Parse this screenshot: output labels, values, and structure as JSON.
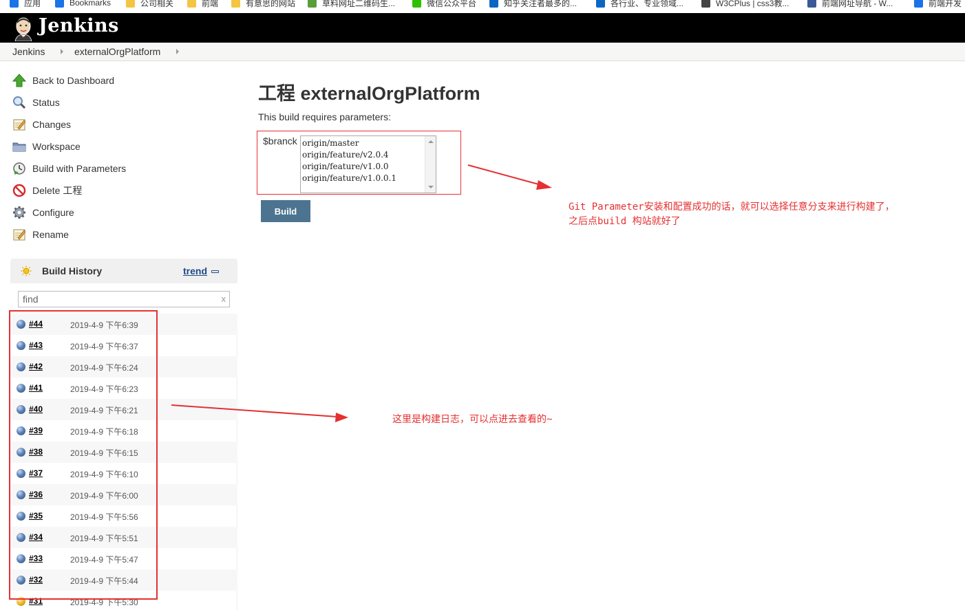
{
  "bookmarks": [
    {
      "label": "应用",
      "icon": "apps-grid-icon",
      "color": "#1a73e8"
    },
    {
      "label": "Bookmarks",
      "icon": "star-icon",
      "color": "#1a73e8"
    },
    {
      "label": "公司相关",
      "icon": "folder-icon",
      "color": "#f4c542"
    },
    {
      "label": "前端",
      "icon": "folder-icon",
      "color": "#f4c542"
    },
    {
      "label": "有意思的网站",
      "icon": "folder-icon",
      "color": "#f4c542"
    },
    {
      "label": "草料网址二维码生...",
      "icon": "qr-icon",
      "color": "#5a9e3a"
    },
    {
      "label": "微信公众平台",
      "icon": "wechat-icon",
      "color": "#2dc100"
    },
    {
      "label": "知乎关注者最多的...",
      "icon": "zhihu-icon",
      "color": "#0a66c2"
    },
    {
      "label": "各行业、专业领域...",
      "icon": "zhihu-icon",
      "color": "#0a66c2"
    },
    {
      "label": "W3CPlus | css3教...",
      "icon": "w3cplus-icon",
      "color": "#444444"
    },
    {
      "label": "前端网址导航 - W...",
      "icon": "grid-icon",
      "color": "#3b5998"
    },
    {
      "label": "前端开发",
      "icon": "circle-icon",
      "color": "#1a73e8"
    }
  ],
  "header": {
    "title": "Jenkins"
  },
  "breadcrumb": [
    "Jenkins",
    "externalOrgPlatform"
  ],
  "tasks": [
    {
      "label": "Back to Dashboard",
      "icon": "up-arrow-icon"
    },
    {
      "label": "Status",
      "icon": "magnifier-icon"
    },
    {
      "label": "Changes",
      "icon": "notepad-icon"
    },
    {
      "label": "Workspace",
      "icon": "folder-icon"
    },
    {
      "label": "Build with Parameters",
      "icon": "clock-play-icon"
    },
    {
      "label": "Delete 工程",
      "icon": "no-entry-icon"
    },
    {
      "label": "Configure",
      "icon": "gear-icon"
    },
    {
      "label": "Rename",
      "icon": "notepad-icon"
    }
  ],
  "build_history": {
    "title": "Build History",
    "trend_label": "trend",
    "filter_placeholder": "find",
    "filter_clear": "x",
    "builds": [
      {
        "number": "#44",
        "date": "2019-4-9 下午6:39",
        "status": "blue"
      },
      {
        "number": "#43",
        "date": "2019-4-9 下午6:37",
        "status": "blue"
      },
      {
        "number": "#42",
        "date": "2019-4-9 下午6:24",
        "status": "blue"
      },
      {
        "number": "#41",
        "date": "2019-4-9 下午6:23",
        "status": "blue"
      },
      {
        "number": "#40",
        "date": "2019-4-9 下午6:21",
        "status": "blue"
      },
      {
        "number": "#39",
        "date": "2019-4-9 下午6:18",
        "status": "blue"
      },
      {
        "number": "#38",
        "date": "2019-4-9 下午6:15",
        "status": "blue"
      },
      {
        "number": "#37",
        "date": "2019-4-9 下午6:10",
        "status": "blue"
      },
      {
        "number": "#36",
        "date": "2019-4-9 下午6:00",
        "status": "blue"
      },
      {
        "number": "#35",
        "date": "2019-4-9 下午5:56",
        "status": "blue"
      },
      {
        "number": "#34",
        "date": "2019-4-9 下午5:51",
        "status": "blue"
      },
      {
        "number": "#33",
        "date": "2019-4-9 下午5:47",
        "status": "blue"
      },
      {
        "number": "#32",
        "date": "2019-4-9 下午5:44",
        "status": "blue"
      },
      {
        "number": "#31",
        "date": "2019-4-9 下午5:30",
        "status": "yellow"
      }
    ]
  },
  "main": {
    "title": "工程 externalOrgPlatform",
    "requires_text": "This build requires parameters:",
    "param_name": "$branck",
    "param_options": [
      "origin/master",
      "origin/feature/v2.0.4",
      "origin/feature/v1.0.0",
      "origin/feature/v1.0.0.1"
    ],
    "build_label": "Build"
  },
  "annotations": {
    "note_parameter_line1": "Git Parameter安装和配置成功的话，就可以选择任意分支来进行构建了，",
    "note_parameter_line2": "之后点build 构站就好了",
    "note_history": "这里是构建日志，可以点进去查看的~",
    "color": "#e53030"
  }
}
